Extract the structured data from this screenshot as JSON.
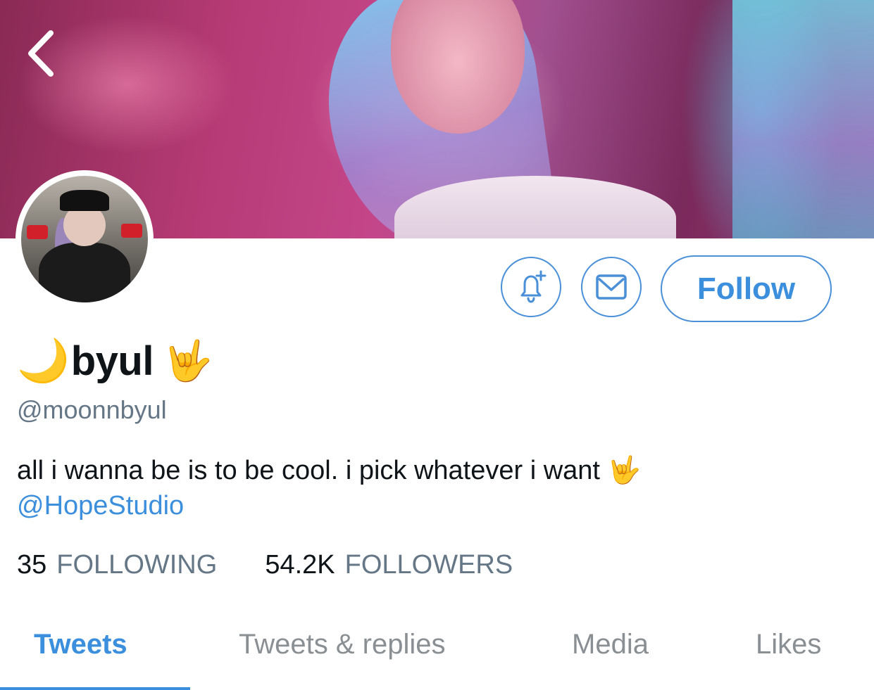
{
  "profile": {
    "display_name": "byul",
    "name_prefix_emoji": "🌙",
    "name_suffix_emoji": "🤟",
    "handle": "@moonnbyul",
    "bio_text": "all i wanna be is to be cool. i pick whatever i want 🤟",
    "bio_link": "@HopeStudio"
  },
  "actions": {
    "follow_label": "Follow",
    "notify_icon": "bell-plus-icon",
    "message_icon": "envelope-icon"
  },
  "stats": {
    "following_count": "35",
    "following_label": "FOLLOWING",
    "followers_count": "54.2K",
    "followers_label": "FOLLOWERS"
  },
  "tabs": [
    {
      "label": "Tweets",
      "active": true
    },
    {
      "label": "Tweets & replies",
      "active": false
    },
    {
      "label": "Media",
      "active": false
    },
    {
      "label": "Likes",
      "active": false
    }
  ],
  "colors": {
    "accent": "#3b8fdd",
    "muted": "#657786"
  }
}
